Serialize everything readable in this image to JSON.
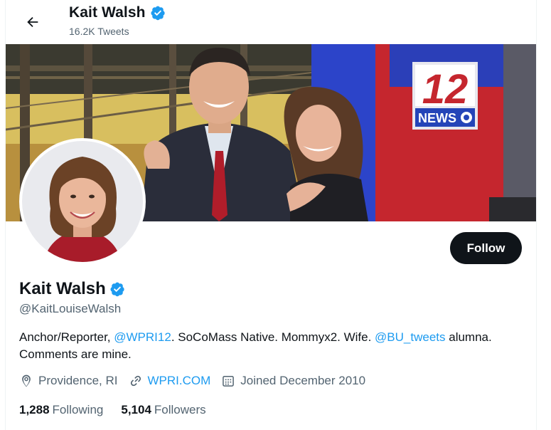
{
  "header": {
    "back_icon": "arrow-left-icon",
    "name": "Kait Walsh",
    "tweet_count": "16.2K Tweets",
    "verified_icon": "verified-badge-icon"
  },
  "banner": {
    "logo_number": "12",
    "logo_text": "NEWS"
  },
  "profile": {
    "follow_label": "Follow",
    "display_name": "Kait Walsh",
    "handle": "@KaitLouiseWalsh",
    "bio": {
      "part1": "Anchor/Reporter, ",
      "mention1": "@WPRI12",
      "part2": ". SoCoMass Native. Mommyx2. Wife. ",
      "mention2": "@BU_tweets",
      "part3": " alumna. Comments are mine."
    },
    "location": "Providence, RI",
    "location_icon": "location-pin-icon",
    "website": "WPRI.COM",
    "website_icon": "link-icon",
    "joined": "Joined December 2010",
    "joined_icon": "calendar-icon",
    "following_count": "1,288",
    "following_label": "Following",
    "followers_count": "5,104",
    "followers_label": "Followers"
  },
  "colors": {
    "accent": "#1d9bf0",
    "text": "#0f1419",
    "secondary": "#536471",
    "button": "#0f1419"
  }
}
